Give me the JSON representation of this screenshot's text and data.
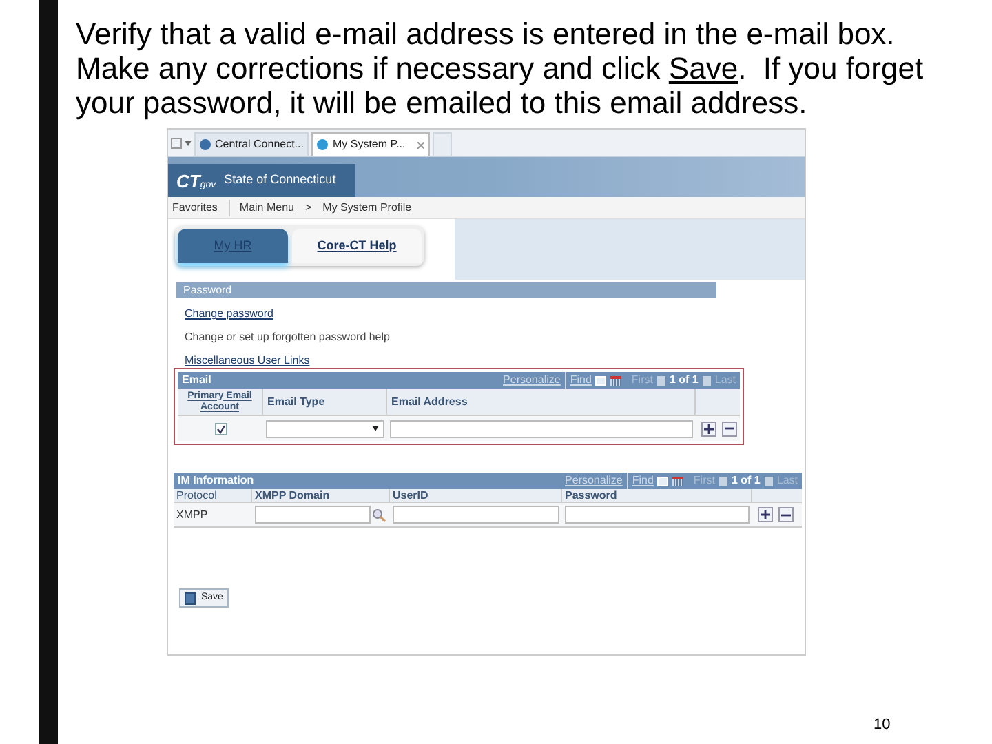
{
  "slide": {
    "text_before": "Verify that a valid e-mail address is entered in the e-mail box. Make any corrections if necessary and click",
    "link": "Save",
    "text_after": ".  If you forget your password, it will be emailed to this email address.",
    "page_number": "10"
  },
  "browser_tabs": [
    {
      "label": "Central Connect...",
      "selected": false
    },
    {
      "label": "My System P...",
      "selected": true
    }
  ],
  "header": {
    "logo": "CT",
    "logo_suffix": "gov",
    "title": "State of Connecticut"
  },
  "nav": {
    "favorites": "Favorites",
    "main_menu": "Main Menu",
    "separator": ">",
    "current": "My System Profile"
  },
  "portal_tabs": [
    {
      "label": "My HR",
      "selected": true
    },
    {
      "label": "Core-CT Help",
      "selected": false
    }
  ],
  "password_section": {
    "title": "Password",
    "items": [
      {
        "label": "Change password",
        "kind": "link"
      },
      {
        "label": "Change or set up forgotten password help",
        "kind": "text"
      },
      {
        "label": "Miscellaneous User Links",
        "kind": "link"
      }
    ]
  },
  "email_grid": {
    "title": "Email",
    "highlighted": true,
    "toolbar": {
      "personalize": "Personalize",
      "find": "Find",
      "first": "First",
      "count": "1 of 1",
      "last": "Last"
    },
    "columns": [
      "Primary Email Account",
      "Email Type",
      "Email Address"
    ],
    "rows": [
      {
        "primary_checked": true
      }
    ]
  },
  "im_grid": {
    "title": "IM Information",
    "toolbar": {
      "personalize": "Personalize",
      "find": "Find",
      "first": "First",
      "count": "1 of 1",
      "last": "Last"
    },
    "columns": [
      "Protocol",
      "XMPP Domain",
      "UserID",
      "Password"
    ],
    "rows": [
      {
        "protocol": "XMPP"
      }
    ]
  },
  "save_button": "Save"
}
